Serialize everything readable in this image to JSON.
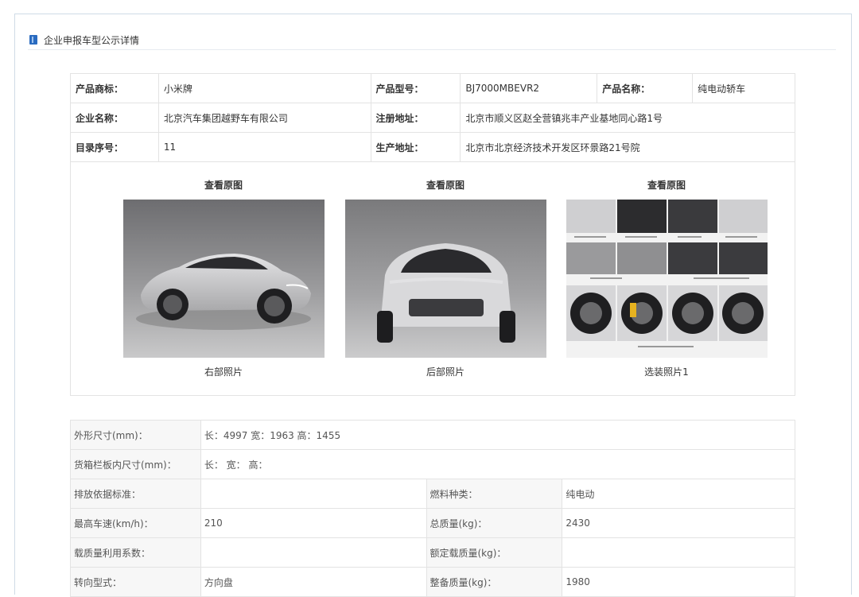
{
  "section_title": "企业申报车型公示详情",
  "info": {
    "trademark_label": "产品商标：",
    "trademark_value": "小米牌",
    "model_label": "产品型号：",
    "model_value": "BJ7000MBEVR2",
    "product_name_label": "产品名称：",
    "product_name_value": "纯电动轿车",
    "company_label": "企业名称：",
    "company_value": "北京汽车集团越野车有限公司",
    "reg_addr_label": "注册地址：",
    "reg_addr_value": "北京市顺义区赵全营镇兆丰产业基地同心路1号",
    "catalog_label": "目录序号：",
    "catalog_value": "11",
    "prod_addr_label": "生产地址：",
    "prod_addr_value": "北京市北京经济技术开发区环景路21号院"
  },
  "photos": [
    {
      "view_label": "查看原图",
      "caption": "右部照片"
    },
    {
      "view_label": "查看原图",
      "caption": "后部照片"
    },
    {
      "view_label": "查看原图",
      "caption": "选装照片1"
    }
  ],
  "specs": {
    "dims_label": "外形尺寸(mm)：",
    "dims_value": "长：4997 宽：1963 高：1455",
    "cargo_label": "货箱栏板内尺寸(mm)：",
    "cargo_value": "长： 宽： 高：",
    "emission_label": "排放依据标准：",
    "emission_value": "",
    "fuel_label": "燃料种类：",
    "fuel_value": "纯电动",
    "speed_label": "最高车速(km/h)：",
    "speed_value": "210",
    "total_mass_label": "总质量(kg)：",
    "total_mass_value": "2430",
    "load_factor_label": "载质量利用系数：",
    "load_factor_value": "",
    "rated_load_label": "额定载质量(kg)：",
    "rated_load_value": "",
    "steering_label": "转向型式：",
    "steering_value": "方向盘",
    "curb_mass_label": "整备质量(kg)：",
    "curb_mass_value": "1980"
  },
  "colors": {
    "border": "#e3e3e3",
    "label_bg": "#f7f7f7",
    "icon": "#2a6bc0"
  }
}
